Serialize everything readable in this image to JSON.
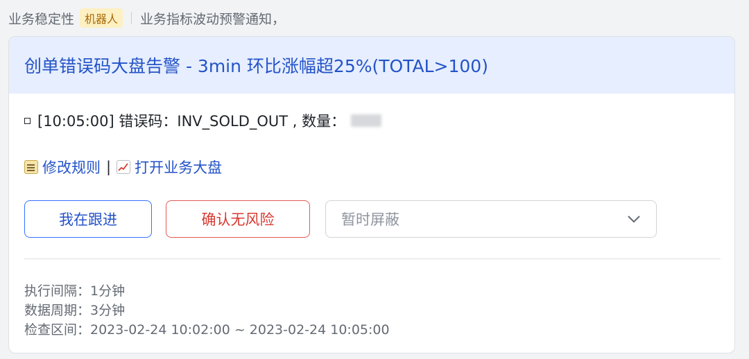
{
  "sender": {
    "name": "业务稳定性",
    "badge": "机器人",
    "summary": "业务指标波动预警通知，"
  },
  "card": {
    "title": "创单错误码大盘告警  - 3min 环比涨幅超25%(TOTAL>100)",
    "alert_line": "[10:05:00] 错误码：INV_SOLD_OUT , 数量：",
    "links": {
      "edit_rule": "修改规则",
      "separator": "|",
      "open_dashboard": "打开业务大盘"
    },
    "actions": {
      "follow_up": "我在跟进",
      "confirm_no_risk": "确认无风险",
      "mute_placeholder": "暂时屏蔽"
    },
    "meta": {
      "interval": "执行间隔：1分钟",
      "period": "数据周期：3分钟",
      "range": "检查区间：2023-02-24 10:02:00 ~ 2023-02-24 10:05:00"
    }
  },
  "colors": {
    "header_bg": "#e6eeff",
    "title": "#2453c7",
    "link": "#2453c7",
    "danger": "#d83931",
    "badge_bg": "#fdf0c2"
  },
  "icons": {
    "edit": "memo-icon",
    "dashboard": "chart-increasing-icon",
    "dropdown": "chevron-down-icon"
  }
}
